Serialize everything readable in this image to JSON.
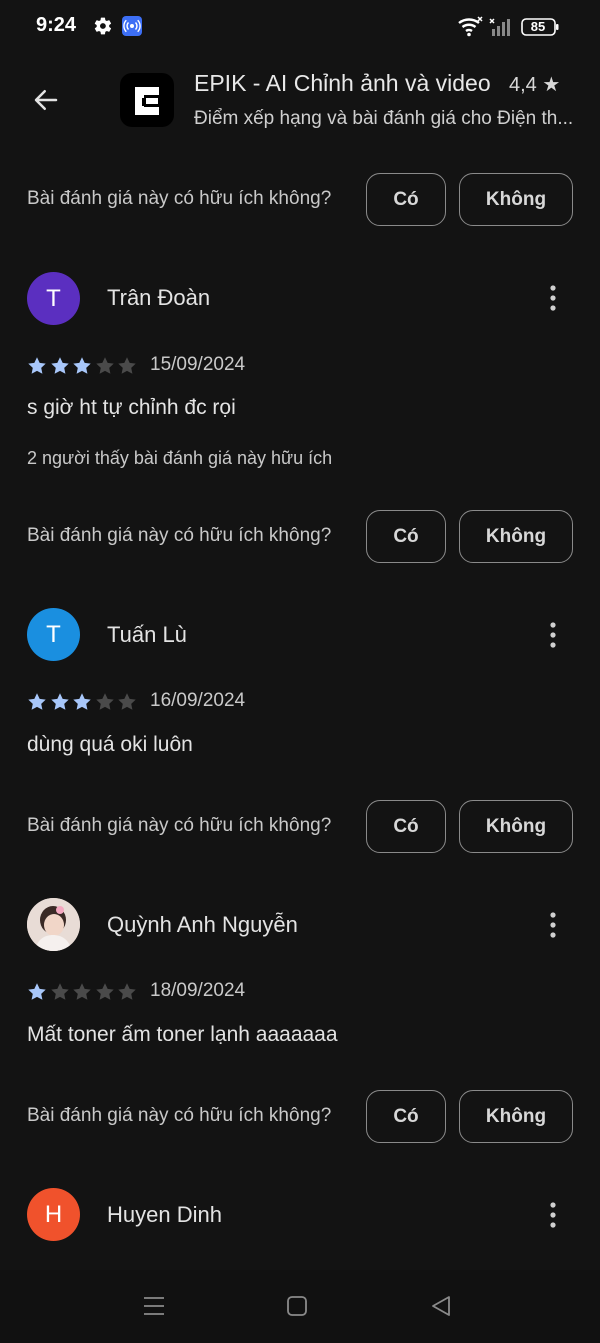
{
  "status_bar": {
    "time": "9:24",
    "battery": "85",
    "icons": [
      "gear-icon",
      "cast-icon",
      "wifi-icon",
      "signal-icon",
      "battery-icon"
    ]
  },
  "header": {
    "app_title": "EPIK - AI Chỉnh ảnh và video",
    "rating": "4,4 ★",
    "subtitle": "Điểm xếp hạng và bài đánh giá cho Điện th..."
  },
  "helpful": {
    "question": "Bài đánh giá này có hữu ích không?",
    "yes_label": "Có",
    "no_label": "Không"
  },
  "reviews": [
    {
      "initial": "T",
      "avatar_color": "#5b2fc0",
      "name": "Trân Đoàn",
      "rating": 3,
      "date": "15/09/2024",
      "text": "s giờ ht tự chỉnh đc rọi",
      "helpful_count": "2 người thấy bài đánh giá này hữu ích"
    },
    {
      "initial": "T",
      "avatar_color": "#1a8fe0",
      "name": "Tuấn Lù",
      "rating": 3,
      "date": "16/09/2024",
      "text": "dùng quá oki luôn"
    },
    {
      "initial": "",
      "avatar_color": "#d9c6c0",
      "name": "Quỳnh Anh Nguyễn",
      "rating": 1,
      "date": "18/09/2024",
      "text": "Mất toner ấm toner lạnh aaaaaaa"
    },
    {
      "initial": "H",
      "avatar_color": "#f0522c",
      "name": "Huyen Dinh"
    }
  ],
  "colors": {
    "background": "#131313",
    "star_filled": "#a8c7fa",
    "star_empty": "#4a4a4a"
  }
}
